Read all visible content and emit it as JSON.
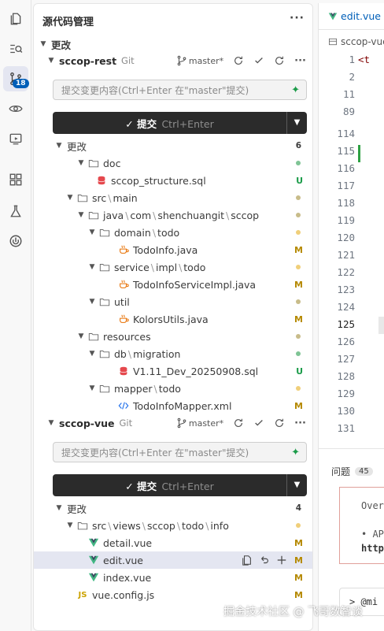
{
  "scm": {
    "title": "源代码管理",
    "more": "···",
    "changes_section": "更改"
  },
  "repos": [
    {
      "name": "sccop-rest",
      "type": "Git",
      "branch": "master*",
      "message_placeholder": "提交变更内容(Ctrl+Enter 在\"master\"提交)",
      "commit_label": "✓ 提交",
      "commit_shortcut": "Ctrl+Enter",
      "changes_label": "更改",
      "changes_count": "6"
    },
    {
      "name": "sccop-vue",
      "type": "Git",
      "branch": "master*",
      "message_placeholder": "提交变更内容(Ctrl+Enter 在\"master\"提交)",
      "commit_label": "✓ 提交",
      "commit_shortcut": "Ctrl+Enter",
      "changes_label": "更改",
      "changes_count": "4"
    }
  ],
  "rest_tree": [
    {
      "label": "doc",
      "kind": "folder",
      "status": "dot-green"
    },
    {
      "label": "sccop_structure.sql",
      "kind": "sql",
      "status": "U"
    },
    {
      "label": [
        "src",
        "main"
      ],
      "kind": "folder",
      "status": "dot-olive"
    },
    {
      "label": [
        "java",
        "com",
        "shenchuangit",
        "sccop"
      ],
      "kind": "folder",
      "status": "dot-olive"
    },
    {
      "label": [
        "domain",
        "todo"
      ],
      "kind": "folder",
      "status": "dot-yellow"
    },
    {
      "label": "TodoInfo.java",
      "kind": "java",
      "status": "M"
    },
    {
      "label": [
        "service",
        "impl",
        "todo"
      ],
      "kind": "folder",
      "status": "dot-yellow"
    },
    {
      "label": "TodoInfoServiceImpl.java",
      "kind": "java",
      "status": "M"
    },
    {
      "label": "util",
      "kind": "folder",
      "status": "dot-olive"
    },
    {
      "label": "KolorsUtils.java",
      "kind": "java",
      "status": "M"
    },
    {
      "label": "resources",
      "kind": "folder",
      "status": "dot-olive"
    },
    {
      "label": [
        "db",
        "migration"
      ],
      "kind": "folder",
      "status": "dot-green"
    },
    {
      "label": "V1.11_Dev_20250908.sql",
      "kind": "sql",
      "status": "U"
    },
    {
      "label": [
        "mapper",
        "todo"
      ],
      "kind": "folder",
      "status": "dot-yellow"
    },
    {
      "label": "TodoInfoMapper.xml",
      "kind": "xml",
      "status": "M"
    }
  ],
  "vue_tree": [
    {
      "label": [
        "src",
        "views",
        "sccop",
        "todo",
        "info"
      ],
      "kind": "folder",
      "status": "dot-yellow"
    },
    {
      "label": "detail.vue",
      "kind": "vue",
      "status": "M"
    },
    {
      "label": "edit.vue",
      "kind": "vue",
      "status": "M"
    },
    {
      "label": "index.vue",
      "kind": "vue",
      "status": "M"
    },
    {
      "label": "vue.config.js",
      "kind": "js",
      "status": "M"
    }
  ],
  "editor": {
    "tab": "edit.vue",
    "breadcrumb": "sccop-vue",
    "code_start": "<t",
    "line_numbers": [
      "1",
      "2",
      "11",
      "89",
      "114",
      "115",
      "116",
      "117",
      "118",
      "119",
      "120",
      "121",
      "122",
      "123",
      "124",
      "125",
      "126",
      "127",
      "128",
      "129",
      "130",
      "131"
    ],
    "problems_label": "问题",
    "problems_count": "45",
    "problem_lines": [
      "Over",
      "• AP",
      "http"
    ],
    "terminal_prompt": "> @mi"
  },
  "watermark": "掘金技术社区 @ 飞哥数智谈",
  "colors": {
    "modified": "#b58900",
    "untracked": "#1c9c4a",
    "accent": "#005fb8"
  }
}
